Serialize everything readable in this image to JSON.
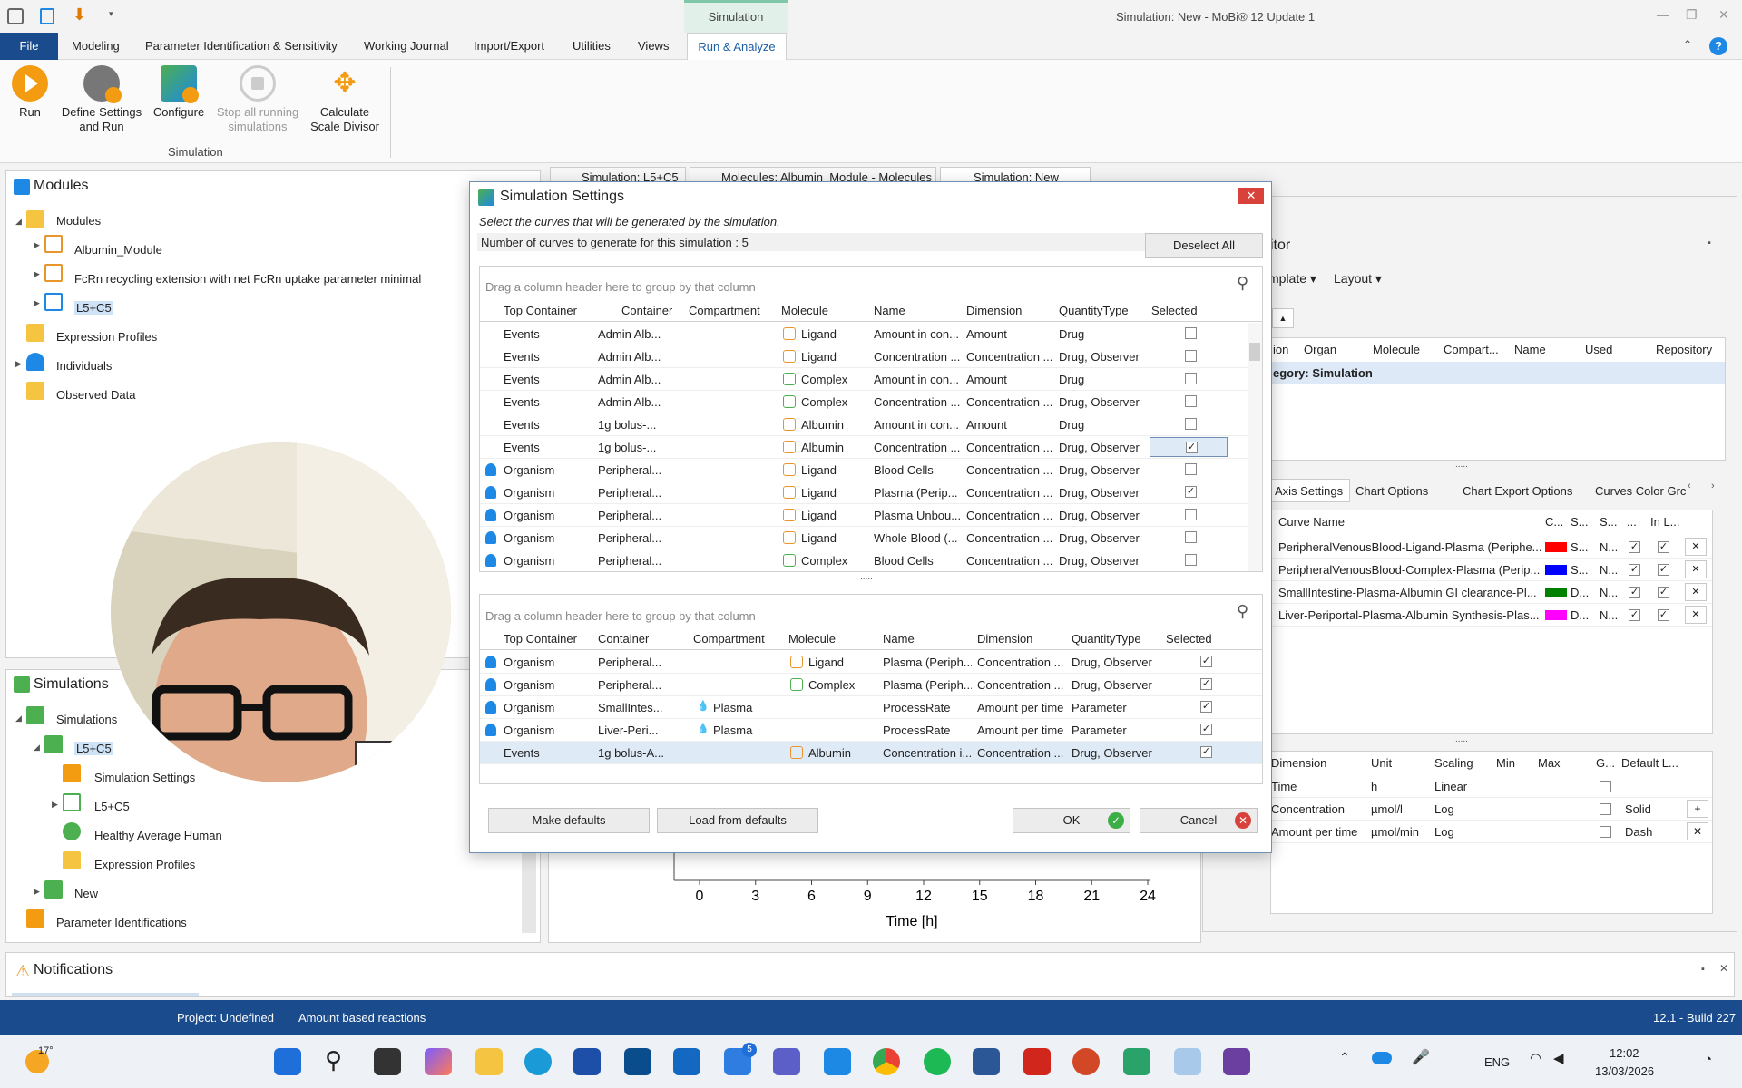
{
  "window": {
    "title": "Simulation: New - MoBi® 12 Update 1",
    "context_tab": "Simulation"
  },
  "menu": {
    "file": "File",
    "items": [
      "Modeling",
      "Parameter Identification & Sensitivity",
      "Working Journal",
      "Import/Export",
      "Utilities",
      "Views"
    ],
    "active": "Run & Analyze"
  },
  "ribbon": {
    "run": "Run",
    "define_settings": "Define Settings",
    "define_settings_2": "and Run",
    "configure": "Configure",
    "stop_all": "Stop all running",
    "stop_all_2": "simulations",
    "calculate": "Calculate",
    "calculate_2": "Scale Divisor",
    "group": "Simulation"
  },
  "modules_panel": {
    "title": "Modules",
    "items": [
      "Modules",
      "Albumin_Module",
      "FcRn recycling extension with net FcRn uptake parameter minimal",
      "L5+C5",
      "Expression Profiles",
      "Individuals",
      "Observed Data"
    ]
  },
  "simulations_panel": {
    "title": "Simulations",
    "items": [
      "Simulations",
      "L5+C5",
      "Simulation Settings",
      "L5+C5",
      "Healthy Average Human",
      "Expression Profiles",
      "New",
      "Parameter Identifications"
    ]
  },
  "doc_tabs": [
    "Simulation: L5+C5",
    "Molecules: Albumin_Module - Molecules",
    "Simulation: New"
  ],
  "dialog": {
    "title": "Simulation Settings",
    "subtitle": "Select the curves that will be generated by the simulation.",
    "count_text": "Number of curves to generate for this simulation : 5",
    "deselect_all": "Deselect All",
    "group_hint": "Drag a column header here to group by that column",
    "columns": [
      "Top Container",
      "Container",
      "Compartment",
      "Molecule",
      "Name",
      "Dimension",
      "QuantityType",
      "Selected"
    ],
    "top_rows": [
      {
        "top": "Events",
        "container": "Admin Alb...",
        "comp": "",
        "mol": "Ligand",
        "name": "Amount in con...",
        "dim": "Amount",
        "qt": "Drug",
        "sel": false
      },
      {
        "top": "Events",
        "container": "Admin Alb...",
        "comp": "",
        "mol": "Ligand",
        "name": "Concentration ...",
        "dim": "Concentration ...",
        "qt": "Drug, Observer",
        "sel": false
      },
      {
        "top": "Events",
        "container": "Admin Alb...",
        "comp": "",
        "mol": "Complex",
        "name": "Amount in con...",
        "dim": "Amount",
        "qt": "Drug",
        "sel": false
      },
      {
        "top": "Events",
        "container": "Admin Alb...",
        "comp": "",
        "mol": "Complex",
        "name": "Concentration ...",
        "dim": "Concentration ...",
        "qt": "Drug, Observer",
        "sel": false
      },
      {
        "top": "Events",
        "container": "1g bolus-...",
        "comp": "",
        "mol": "Albumin",
        "name": "Amount in con...",
        "dim": "Amount",
        "qt": "Drug",
        "sel": false
      },
      {
        "top": "Events",
        "container": "1g bolus-...",
        "comp": "",
        "mol": "Albumin",
        "name": "Concentration ...",
        "dim": "Concentration ...",
        "qt": "Drug, Observer",
        "sel": true
      },
      {
        "top": "Organism",
        "container": "Peripheral...",
        "comp": "",
        "mol": "Ligand",
        "name": "Blood Cells",
        "dim": "Concentration ...",
        "qt": "Drug, Observer",
        "sel": false
      },
      {
        "top": "Organism",
        "container": "Peripheral...",
        "comp": "",
        "mol": "Ligand",
        "name": "Plasma (Perip...",
        "dim": "Concentration ...",
        "qt": "Drug, Observer",
        "sel": true
      },
      {
        "top": "Organism",
        "container": "Peripheral...",
        "comp": "",
        "mol": "Ligand",
        "name": "Plasma Unbou...",
        "dim": "Concentration ...",
        "qt": "Drug, Observer",
        "sel": false
      },
      {
        "top": "Organism",
        "container": "Peripheral...",
        "comp": "",
        "mol": "Ligand",
        "name": "Whole Blood (...",
        "dim": "Concentration ...",
        "qt": "Drug, Observer",
        "sel": false
      },
      {
        "top": "Organism",
        "container": "Peripheral...",
        "comp": "",
        "mol": "Complex",
        "name": "Blood Cells",
        "dim": "Concentration ...",
        "qt": "Drug, Observer",
        "sel": false
      }
    ],
    "bottom_rows": [
      {
        "top": "Organism",
        "container": "Peripheral...",
        "comp": "",
        "mol": "Ligand",
        "name": "Plasma (Periph...",
        "dim": "Concentration ...",
        "qt": "Drug, Observer",
        "sel": true
      },
      {
        "top": "Organism",
        "container": "Peripheral...",
        "comp": "",
        "mol": "Complex",
        "name": "Plasma (Periph...",
        "dim": "Concentration ...",
        "qt": "Drug, Observer",
        "sel": true
      },
      {
        "top": "Organism",
        "container": "SmallIntes...",
        "comp": "Plasma",
        "mol": "",
        "name": "ProcessRate",
        "dim": "Amount per time",
        "qt": "Parameter",
        "sel": true
      },
      {
        "top": "Organism",
        "container": "Liver-Peri...",
        "comp": "Plasma",
        "mol": "",
        "name": "ProcessRate",
        "dim": "Amount per time",
        "qt": "Parameter",
        "sel": true
      },
      {
        "top": "Events",
        "container": "1g bolus-A...",
        "comp": "",
        "mol": "Albumin",
        "name": "Concentration i...",
        "dim": "Concentration ...",
        "qt": "Drug, Observer",
        "sel": true
      }
    ],
    "make_defaults": "Make defaults",
    "load_defaults": "Load from defaults",
    "ok": "OK",
    "cancel": "Cancel"
  },
  "chart_editor": {
    "title_fragment": "itor",
    "template_btn": "mplate",
    "layout_btn": "Layout",
    "columns": [
      "ion",
      "Organ",
      "Molecule",
      "Compart...",
      "Name",
      "Used",
      "Repository"
    ],
    "category_row": "egory: Simulation",
    "tabs": [
      "Axis Settings",
      "Chart Options",
      "Chart Export Options",
      "Curves Color Grc"
    ],
    "curve_columns": [
      "Curve Name",
      "C...",
      "S...",
      "S...",
      "...",
      "In L..."
    ],
    "curves": [
      {
        "name": "PeripheralVenousBlood-Ligand-Plasma (Periphe...",
        "color": "#ff0000",
        "s1": "S...",
        "s2": "N..."
      },
      {
        "name": "PeripheralVenousBlood-Complex-Plasma (Perip...",
        "color": "#0000ff",
        "s1": "S...",
        "s2": "N..."
      },
      {
        "name": "SmallIntestine-Plasma-Albumin GI clearance-Pl...",
        "color": "#008000",
        "s1": "D...",
        "s2": "N..."
      },
      {
        "name": "Liver-Periportal-Plasma-Albumin Synthesis-Plas...",
        "color": "#ff00ff",
        "s1": "D...",
        "s2": "N..."
      }
    ],
    "axis_columns": [
      "Dimension",
      "Unit",
      "Scaling",
      "Min",
      "Max",
      "G...",
      "Default L..."
    ],
    "axes": [
      {
        "dim": "Time",
        "unit": "h",
        "scaling": "Linear",
        "def": ""
      },
      {
        "dim": "Concentration",
        "unit": "µmol/l",
        "scaling": "Log",
        "def": "Solid"
      },
      {
        "dim": "Amount per time",
        "unit": "µmol/min",
        "scaling": "Log",
        "def": "Dash"
      }
    ]
  },
  "chart_data": {
    "type": "line",
    "x_ticks": [
      "0",
      "3",
      "6",
      "9",
      "12",
      "15",
      "18",
      "21",
      "24"
    ],
    "xlabel": "Time [h]"
  },
  "notifications": {
    "title": "Notifications"
  },
  "status": {
    "project": "Project: Undefined",
    "reactions": "Amount based reactions",
    "build": "12.1 - Build 227"
  },
  "taskbar": {
    "weather": "17°",
    "lang": "ENG",
    "time": "12:02",
    "date": "13/03/2026",
    "badge": "5"
  }
}
